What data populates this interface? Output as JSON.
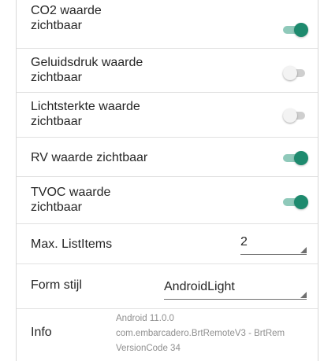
{
  "settings": {
    "toggles": [
      {
        "label_line1": "CO2 waarde",
        "label_line2": "zichtbaar",
        "checked": true
      },
      {
        "label_line1": "Geluidsdruk waarde",
        "label_line2": "zichtbaar",
        "checked": false
      },
      {
        "label_line1": "Lichtsterkte waarde",
        "label_line2": "zichtbaar",
        "checked": false
      },
      {
        "label_line1": "RV waarde zichtbaar",
        "label_line2": "",
        "checked": true
      },
      {
        "label_line1": "TVOC waarde",
        "label_line2": "zichtbaar",
        "checked": true
      }
    ],
    "max_list_items": {
      "label": "Max. ListItems",
      "value": "2"
    },
    "form_style": {
      "label": "Form stijl",
      "value": "AndroidLight"
    },
    "info": {
      "label": "Info",
      "android_version": "Android 11.0.0",
      "package": "com.embarcadero.BrtRemoteV3 - BrtRem",
      "version_code": "VersionCode 34"
    }
  },
  "colors": {
    "toggle_on_thumb": "#1e8a6e",
    "toggle_on_track": "#8fc9ba",
    "toggle_off_thumb": "#f3f3f3",
    "toggle_off_track": "#cfcfcf",
    "divider": "#e2e2e2",
    "secondary_text": "#8f8f8f"
  }
}
